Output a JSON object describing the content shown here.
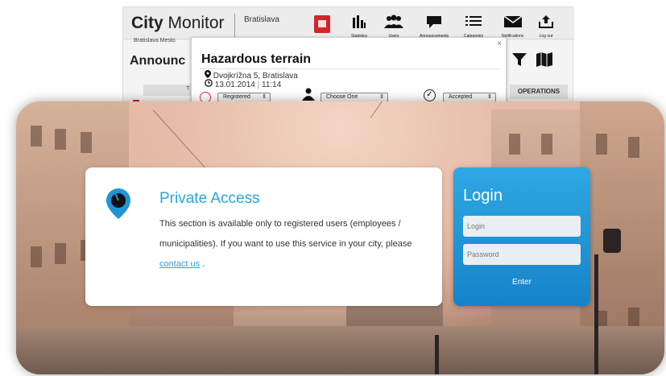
{
  "app": {
    "brand_bold": "City",
    "brand_rest": " Monitor",
    "brand_sub": "Bratislava Mesto",
    "city": "Bratislava",
    "nav": [
      {
        "icon": "bar-chart-icon",
        "glyph": "▮▮▮",
        "label": "Statistics"
      },
      {
        "icon": "users-icon",
        "glyph": "👥",
        "label": "Users"
      },
      {
        "icon": "speech-bubble-icon",
        "glyph": "💬",
        "label": "Announcements"
      },
      {
        "icon": "list-icon",
        "glyph": "☰",
        "label": "Categories"
      },
      {
        "icon": "envelope-icon",
        "glyph": "✉",
        "label": "Notifications"
      },
      {
        "icon": "logout-icon",
        "glyph": "⇪",
        "label": "Log out"
      }
    ],
    "section_title": "Announc",
    "table_head_letter": "T",
    "operations_label": "OPERATIONS"
  },
  "popup": {
    "close_glyph": "×",
    "title": "Hazardous terrain",
    "address": "Dvojkrížna 5, Bratislava",
    "date": "13.01.2014",
    "time": "11:14",
    "status_value": "Registered",
    "assignee_value": "Choose One",
    "approval_value": "Accepted"
  },
  "private_access": {
    "title": "Private Access",
    "text_before": "This section is available only to registered users (employees / municipalities). If you want to use this service in your city, please ",
    "link_text": "contact us",
    "text_after": " ."
  },
  "login": {
    "title": "Login",
    "login_placeholder": "Login",
    "password_placeholder": "Password",
    "enter_label": "Enter"
  },
  "colors": {
    "accent": "#27a6dc",
    "login_bg": "#1f95d8",
    "coat_red": "#d0262b"
  }
}
